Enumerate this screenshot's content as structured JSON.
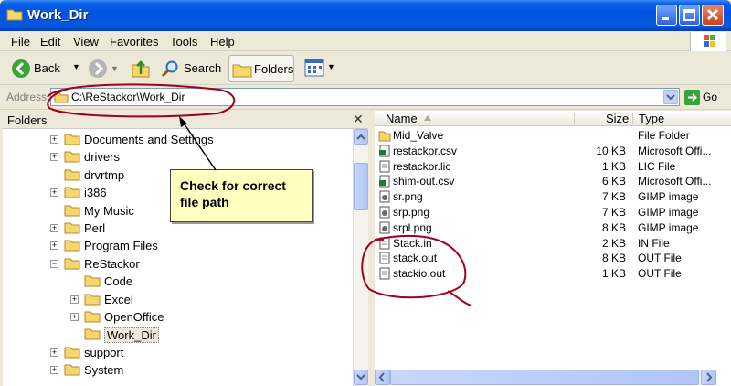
{
  "window": {
    "title": "Work_Dir"
  },
  "menu": [
    "File",
    "Edit",
    "View",
    "Favorites",
    "Tools",
    "Help"
  ],
  "toolbar": {
    "back_label": "Back",
    "search_label": "Search",
    "folders_label": "Folders"
  },
  "address": {
    "label": "Address",
    "path": "C:\\ReStackor\\Work_Dir",
    "go_label": "Go"
  },
  "folders_pane": {
    "title": "Folders",
    "items": [
      {
        "label": "Documents and Settings",
        "expand": "+"
      },
      {
        "label": "drivers",
        "expand": "+"
      },
      {
        "label": "drvrtmp",
        "expand": ""
      },
      {
        "label": "i386",
        "expand": "+"
      },
      {
        "label": "My Music",
        "expand": ""
      },
      {
        "label": "Perl",
        "expand": "+"
      },
      {
        "label": "Program Files",
        "expand": "+"
      },
      {
        "label": "ReStackor",
        "expand": "−"
      },
      {
        "label": "Code",
        "expand": ""
      },
      {
        "label": "Excel",
        "expand": "+"
      },
      {
        "label": "OpenOffice",
        "expand": "+"
      },
      {
        "label": "Work_Dir",
        "expand": ""
      },
      {
        "label": "support",
        "expand": "+"
      },
      {
        "label": "System",
        "expand": "+"
      }
    ]
  },
  "files": {
    "columns": {
      "name": "Name",
      "size": "Size",
      "type": "Type"
    },
    "rows": [
      {
        "name": "Mid_Valve",
        "size": "",
        "type": "File Folder",
        "icon": "folder-icon"
      },
      {
        "name": "restackor.csv",
        "size": "10 KB",
        "type": "Microsoft Offi...",
        "icon": "csv-icon"
      },
      {
        "name": "restackor.lic",
        "size": "1 KB",
        "type": "LIC File",
        "icon": "file-icon"
      },
      {
        "name": "shim-out.csv",
        "size": "6 KB",
        "type": "Microsoft Offi...",
        "icon": "csv-icon"
      },
      {
        "name": "sr.png",
        "size": "7 KB",
        "type": "GIMP image",
        "icon": "image-icon"
      },
      {
        "name": "srp.png",
        "size": "7 KB",
        "type": "GIMP image",
        "icon": "image-icon"
      },
      {
        "name": "srpl.png",
        "size": "8 KB",
        "type": "GIMP image",
        "icon": "image-icon"
      },
      {
        "name": "Stack.in",
        "size": "2 KB",
        "type": "IN File",
        "icon": "file-icon"
      },
      {
        "name": "stack.out",
        "size": "8 KB",
        "type": "OUT File",
        "icon": "file-icon"
      },
      {
        "name": "stackio.out",
        "size": "1 KB",
        "type": "OUT File",
        "icon": "file-icon"
      }
    ]
  },
  "callout": {
    "line1": "Check for correct",
    "line2": "file path"
  },
  "colors": {
    "titlebar": "#0054e3",
    "annotation": "#a3001e",
    "callout_bg": "#ffffc0",
    "folder": "#f5d76e"
  }
}
